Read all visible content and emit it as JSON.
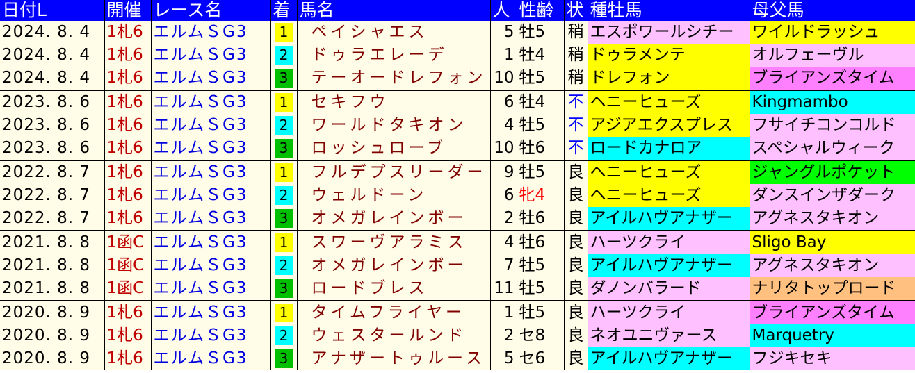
{
  "table": {
    "headers": {
      "date": "日付L",
      "venue": "開催",
      "race": "レース名",
      "rank": "着",
      "horse": "馬名",
      "pop": "人",
      "sexage": "性齢",
      "cond": "状",
      "sire": "種牡馬",
      "damsire": "母父馬"
    },
    "colors": {
      "header_bg": "#0000ff",
      "row_bg": "#fffde8",
      "rank_1": "#ffff00",
      "rank_2": "#00ffff",
      "rank_3": "#00c000",
      "sire_pink": "#ffc0ff",
      "sire_yellow": "#ffff00",
      "sire_cyan": "#00ffff",
      "sire_green": "#00ff00",
      "sire_orange": "#ffc080"
    },
    "rows": [
      {
        "date": "2024. 8. 4",
        "venue": "1札6",
        "race": "エルムＳG3",
        "rank": "1",
        "horse": "ペイシャエス",
        "pop": "5",
        "sexage": "牡5",
        "cond": "稍",
        "sire": "エスポワールシチー",
        "sire_color": "#ffc0ff",
        "damsire": "ワイルドラッシュ",
        "damsire_color": "#ffff00"
      },
      {
        "date": "2024. 8. 4",
        "venue": "1札6",
        "race": "エルムＳG3",
        "rank": "2",
        "horse": "ドゥラエレーデ",
        "pop": "1",
        "sexage": "牡4",
        "cond": "稍",
        "sire": "ドゥラメンテ",
        "sire_color": "#ffff00",
        "damsire": "オルフェーヴル",
        "damsire_color": "#ffc0ff"
      },
      {
        "date": "2024. 8. 4",
        "venue": "1札6",
        "race": "エルムＳG3",
        "rank": "3",
        "horse": "テーオードレフォン",
        "pop": "10",
        "sexage": "牡5",
        "cond": "稍",
        "sire": "ドレフォン",
        "sire_color": "#ffff00",
        "damsire": "ブライアンズタイム",
        "damsire_color": "#ff80ff"
      },
      {
        "date": "2023. 8. 6",
        "venue": "1札6",
        "race": "エルムＳG3",
        "rank": "1",
        "horse": "セキフウ",
        "pop": "6",
        "sexage": "牡4",
        "cond": "不",
        "sire": "ヘニーヒューズ",
        "sire_color": "#ffff00",
        "damsire": "Kingmambo",
        "damsire_color": "#00ffff"
      },
      {
        "date": "2023. 8. 6",
        "venue": "1札6",
        "race": "エルムＳG3",
        "rank": "2",
        "horse": "ワールドタキオン",
        "pop": "4",
        "sexage": "牡5",
        "cond": "不",
        "sire": "アジアエクスプレス",
        "sire_color": "#ffff00",
        "damsire": "フサイチコンコルド",
        "damsire_color": "#ffc0ff"
      },
      {
        "date": "2023. 8. 6",
        "venue": "1札6",
        "race": "エルムＳG3",
        "rank": "3",
        "horse": "ロッシュローブ",
        "pop": "10",
        "sexage": "牡6",
        "cond": "不",
        "sire": "ロードカナロア",
        "sire_color": "#00ffff",
        "damsire": "スペシャルウィーク",
        "damsire_color": "#ffc0ff"
      },
      {
        "date": "2022. 8. 7",
        "venue": "1札6",
        "race": "エルムＳG3",
        "rank": "1",
        "horse": "フルデプスリーダー",
        "pop": "9",
        "sexage": "牡5",
        "cond": "良",
        "sire": "ヘニーヒューズ",
        "sire_color": "#ffff00",
        "damsire": "ジャングルポケット",
        "damsire_color": "#00ff00"
      },
      {
        "date": "2022. 8. 7",
        "venue": "1札6",
        "race": "エルムＳG3",
        "rank": "2",
        "horse": "ウェルドーン",
        "pop": "6",
        "sexage": "牝4",
        "cond": "良",
        "sire": "ヘニーヒューズ",
        "sire_color": "#ffff00",
        "damsire": "ダンスインザダーク",
        "damsire_color": "#ffc0ff"
      },
      {
        "date": "2022. 8. 7",
        "venue": "1札6",
        "race": "エルムＳG3",
        "rank": "3",
        "horse": "オメガレインボー",
        "pop": "2",
        "sexage": "牡6",
        "cond": "良",
        "sire": "アイルハヴアナザー",
        "sire_color": "#00ffff",
        "damsire": "アグネスタキオン",
        "damsire_color": "#ffc0ff"
      },
      {
        "date": "2021. 8. 8",
        "venue": "1函C",
        "race": "エルムＳG3",
        "rank": "1",
        "horse": "スワーヴアラミス",
        "pop": "4",
        "sexage": "牡6",
        "cond": "良",
        "sire": "ハーツクライ",
        "sire_color": "#ffc0ff",
        "damsire": "Sligo Bay",
        "damsire_color": "#ffff00"
      },
      {
        "date": "2021. 8. 8",
        "venue": "1函C",
        "race": "エルムＳG3",
        "rank": "2",
        "horse": "オメガレインボー",
        "pop": "7",
        "sexage": "牡5",
        "cond": "良",
        "sire": "アイルハヴアナザー",
        "sire_color": "#00ffff",
        "damsire": "アグネスタキオン",
        "damsire_color": "#ffc0ff"
      },
      {
        "date": "2021. 8. 8",
        "venue": "1函C",
        "race": "エルムＳG3",
        "rank": "3",
        "horse": "ロードブレス",
        "pop": "11",
        "sexage": "牡5",
        "cond": "良",
        "sire": "ダノンバラード",
        "sire_color": "#ffc0ff",
        "damsire": "ナリタトップロード",
        "damsire_color": "#ffc080"
      },
      {
        "date": "2020. 8. 9",
        "venue": "1札6",
        "race": "エルムＳG3",
        "rank": "1",
        "horse": "タイムフライヤー",
        "pop": "1",
        "sexage": "牡5",
        "cond": "良",
        "sire": "ハーツクライ",
        "sire_color": "#ffc0ff",
        "damsire": "ブライアンズタイム",
        "damsire_color": "#ff80ff"
      },
      {
        "date": "2020. 8. 9",
        "venue": "1札6",
        "race": "エルムＳG3",
        "rank": "2",
        "horse": "ウェスタールンド",
        "pop": "2",
        "sexage": "セ8",
        "cond": "良",
        "sire": "ネオユニヴァース",
        "sire_color": "#ffc0ff",
        "damsire": "Marquetry",
        "damsire_color": "#00ffff"
      },
      {
        "date": "2020. 8. 9",
        "venue": "1札6",
        "race": "エルムＳG3",
        "rank": "3",
        "horse": "アナザートゥルース",
        "pop": "5",
        "sexage": "セ6",
        "cond": "良",
        "sire": "アイルハヴアナザー",
        "sire_color": "#00ffff",
        "damsire": "フジキセキ",
        "damsire_color": "#ffc0ff"
      }
    ]
  }
}
